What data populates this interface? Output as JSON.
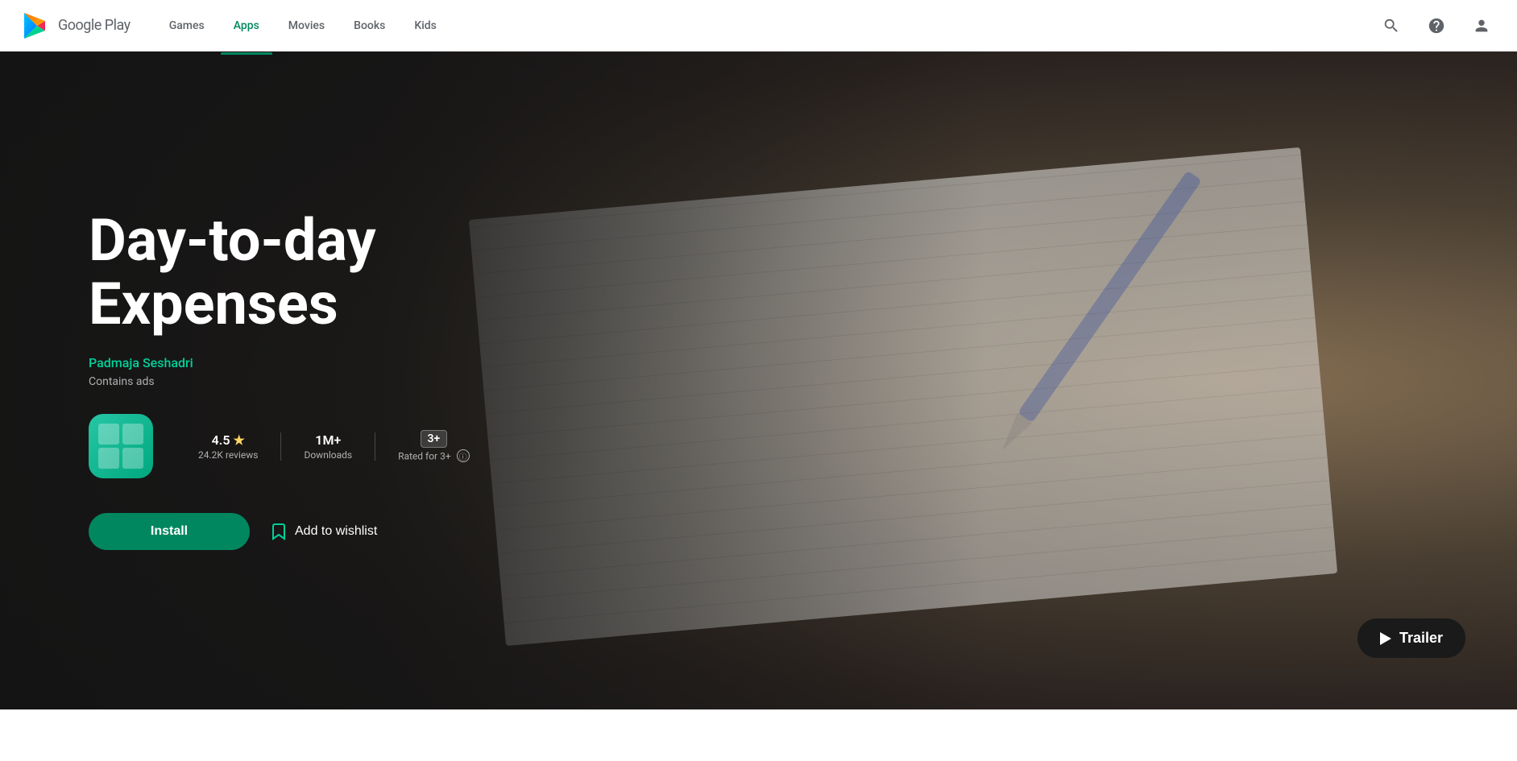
{
  "header": {
    "logo_text": "Google Play",
    "nav": [
      {
        "id": "games",
        "label": "Games",
        "active": false
      },
      {
        "id": "apps",
        "label": "Apps",
        "active": true
      },
      {
        "id": "movies",
        "label": "Movies",
        "active": false
      },
      {
        "id": "books",
        "label": "Books",
        "active": false
      },
      {
        "id": "kids",
        "label": "Kids",
        "active": false
      }
    ],
    "search_label": "Search",
    "help_label": "Help",
    "account_label": "Account"
  },
  "hero": {
    "title_line1": "Day-to-day",
    "title_line2": "Expenses",
    "author": "Padmaja Seshadri",
    "contains_ads": "Contains ads",
    "rating": "4.5",
    "rating_star": "★",
    "reviews": "24.2K reviews",
    "downloads": "1M+",
    "downloads_label": "Downloads",
    "age_rating": "3+",
    "age_label": "Rated for 3+",
    "install_label": "Install",
    "wishlist_label": "Add to wishlist",
    "trailer_label": "Trailer"
  }
}
